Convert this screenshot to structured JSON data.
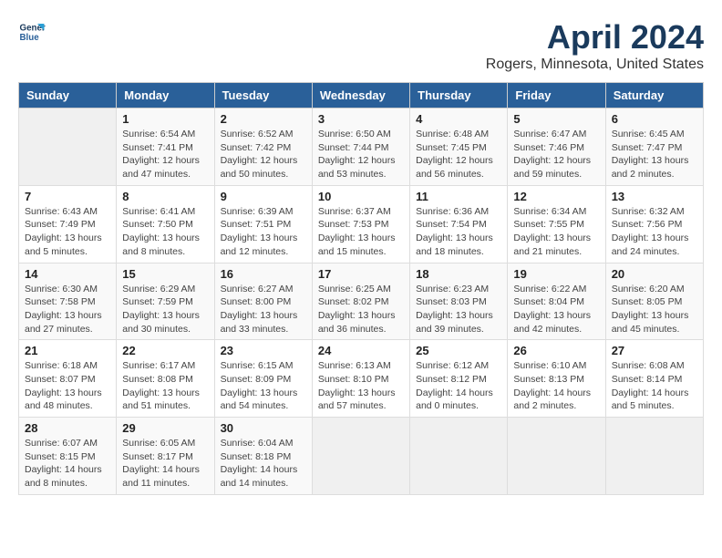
{
  "header": {
    "logo_line1": "General",
    "logo_line2": "Blue",
    "title": "April 2024",
    "subtitle": "Rogers, Minnesota, United States"
  },
  "calendar": {
    "days_of_week": [
      "Sunday",
      "Monday",
      "Tuesday",
      "Wednesday",
      "Thursday",
      "Friday",
      "Saturday"
    ],
    "weeks": [
      [
        {
          "day": "",
          "info": ""
        },
        {
          "day": "1",
          "info": "Sunrise: 6:54 AM\nSunset: 7:41 PM\nDaylight: 12 hours\nand 47 minutes."
        },
        {
          "day": "2",
          "info": "Sunrise: 6:52 AM\nSunset: 7:42 PM\nDaylight: 12 hours\nand 50 minutes."
        },
        {
          "day": "3",
          "info": "Sunrise: 6:50 AM\nSunset: 7:44 PM\nDaylight: 12 hours\nand 53 minutes."
        },
        {
          "day": "4",
          "info": "Sunrise: 6:48 AM\nSunset: 7:45 PM\nDaylight: 12 hours\nand 56 minutes."
        },
        {
          "day": "5",
          "info": "Sunrise: 6:47 AM\nSunset: 7:46 PM\nDaylight: 12 hours\nand 59 minutes."
        },
        {
          "day": "6",
          "info": "Sunrise: 6:45 AM\nSunset: 7:47 PM\nDaylight: 13 hours\nand 2 minutes."
        }
      ],
      [
        {
          "day": "7",
          "info": "Sunrise: 6:43 AM\nSunset: 7:49 PM\nDaylight: 13 hours\nand 5 minutes."
        },
        {
          "day": "8",
          "info": "Sunrise: 6:41 AM\nSunset: 7:50 PM\nDaylight: 13 hours\nand 8 minutes."
        },
        {
          "day": "9",
          "info": "Sunrise: 6:39 AM\nSunset: 7:51 PM\nDaylight: 13 hours\nand 12 minutes."
        },
        {
          "day": "10",
          "info": "Sunrise: 6:37 AM\nSunset: 7:53 PM\nDaylight: 13 hours\nand 15 minutes."
        },
        {
          "day": "11",
          "info": "Sunrise: 6:36 AM\nSunset: 7:54 PM\nDaylight: 13 hours\nand 18 minutes."
        },
        {
          "day": "12",
          "info": "Sunrise: 6:34 AM\nSunset: 7:55 PM\nDaylight: 13 hours\nand 21 minutes."
        },
        {
          "day": "13",
          "info": "Sunrise: 6:32 AM\nSunset: 7:56 PM\nDaylight: 13 hours\nand 24 minutes."
        }
      ],
      [
        {
          "day": "14",
          "info": "Sunrise: 6:30 AM\nSunset: 7:58 PM\nDaylight: 13 hours\nand 27 minutes."
        },
        {
          "day": "15",
          "info": "Sunrise: 6:29 AM\nSunset: 7:59 PM\nDaylight: 13 hours\nand 30 minutes."
        },
        {
          "day": "16",
          "info": "Sunrise: 6:27 AM\nSunset: 8:00 PM\nDaylight: 13 hours\nand 33 minutes."
        },
        {
          "day": "17",
          "info": "Sunrise: 6:25 AM\nSunset: 8:02 PM\nDaylight: 13 hours\nand 36 minutes."
        },
        {
          "day": "18",
          "info": "Sunrise: 6:23 AM\nSunset: 8:03 PM\nDaylight: 13 hours\nand 39 minutes."
        },
        {
          "day": "19",
          "info": "Sunrise: 6:22 AM\nSunset: 8:04 PM\nDaylight: 13 hours\nand 42 minutes."
        },
        {
          "day": "20",
          "info": "Sunrise: 6:20 AM\nSunset: 8:05 PM\nDaylight: 13 hours\nand 45 minutes."
        }
      ],
      [
        {
          "day": "21",
          "info": "Sunrise: 6:18 AM\nSunset: 8:07 PM\nDaylight: 13 hours\nand 48 minutes."
        },
        {
          "day": "22",
          "info": "Sunrise: 6:17 AM\nSunset: 8:08 PM\nDaylight: 13 hours\nand 51 minutes."
        },
        {
          "day": "23",
          "info": "Sunrise: 6:15 AM\nSunset: 8:09 PM\nDaylight: 13 hours\nand 54 minutes."
        },
        {
          "day": "24",
          "info": "Sunrise: 6:13 AM\nSunset: 8:10 PM\nDaylight: 13 hours\nand 57 minutes."
        },
        {
          "day": "25",
          "info": "Sunrise: 6:12 AM\nSunset: 8:12 PM\nDaylight: 14 hours\nand 0 minutes."
        },
        {
          "day": "26",
          "info": "Sunrise: 6:10 AM\nSunset: 8:13 PM\nDaylight: 14 hours\nand 2 minutes."
        },
        {
          "day": "27",
          "info": "Sunrise: 6:08 AM\nSunset: 8:14 PM\nDaylight: 14 hours\nand 5 minutes."
        }
      ],
      [
        {
          "day": "28",
          "info": "Sunrise: 6:07 AM\nSunset: 8:15 PM\nDaylight: 14 hours\nand 8 minutes."
        },
        {
          "day": "29",
          "info": "Sunrise: 6:05 AM\nSunset: 8:17 PM\nDaylight: 14 hours\nand 11 minutes."
        },
        {
          "day": "30",
          "info": "Sunrise: 6:04 AM\nSunset: 8:18 PM\nDaylight: 14 hours\nand 14 minutes."
        },
        {
          "day": "",
          "info": ""
        },
        {
          "day": "",
          "info": ""
        },
        {
          "day": "",
          "info": ""
        },
        {
          "day": "",
          "info": ""
        }
      ]
    ]
  }
}
